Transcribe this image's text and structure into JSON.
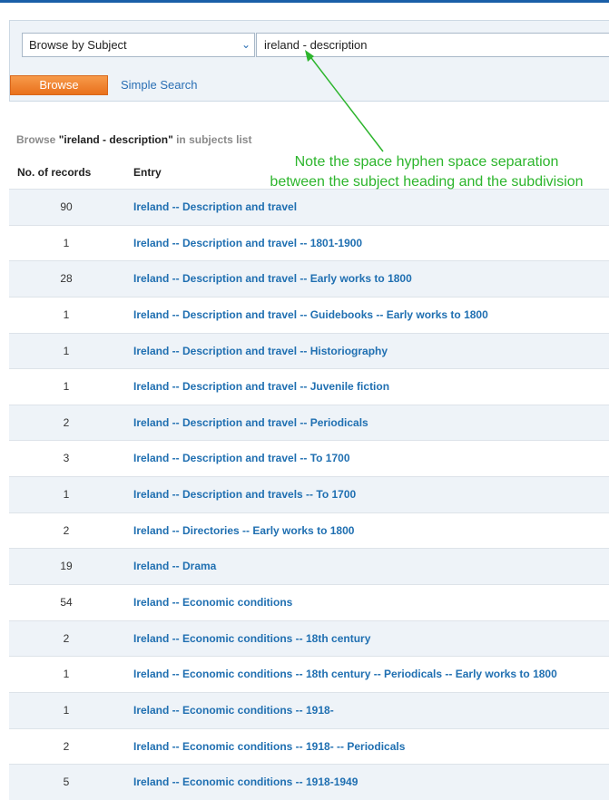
{
  "search": {
    "select_value": "Browse by Subject",
    "input_value": "ireland - description",
    "browse_label": "Browse",
    "simple_search_label": "Simple Search"
  },
  "results": {
    "heading_prefix": "Browse ",
    "heading_term": "\"ireland - description\"",
    "heading_suffix": " in subjects list",
    "col_records": "No. of records",
    "col_entry": "Entry",
    "rows": [
      {
        "count": "90",
        "entry": "Ireland -- Description and travel"
      },
      {
        "count": "1",
        "entry": "Ireland -- Description and travel -- 1801-1900"
      },
      {
        "count": "28",
        "entry": "Ireland -- Description and travel -- Early works to 1800"
      },
      {
        "count": "1",
        "entry": "Ireland -- Description and travel -- Guidebooks -- Early works to 1800"
      },
      {
        "count": "1",
        "entry": "Ireland -- Description and travel -- Historiography"
      },
      {
        "count": "1",
        "entry": "Ireland -- Description and travel -- Juvenile fiction"
      },
      {
        "count": "2",
        "entry": "Ireland -- Description and travel -- Periodicals"
      },
      {
        "count": "3",
        "entry": "Ireland -- Description and travel -- To 1700"
      },
      {
        "count": "1",
        "entry": "Ireland -- Description and travels -- To 1700"
      },
      {
        "count": "2",
        "entry": "Ireland -- Directories -- Early works to 1800"
      },
      {
        "count": "19",
        "entry": "Ireland -- Drama"
      },
      {
        "count": "54",
        "entry": "Ireland -- Economic conditions"
      },
      {
        "count": "2",
        "entry": "Ireland -- Economic conditions -- 18th century"
      },
      {
        "count": "1",
        "entry": "Ireland -- Economic conditions -- 18th century -- Periodicals -- Early works to 1800"
      },
      {
        "count": "1",
        "entry": "Ireland -- Economic conditions -- 1918-"
      },
      {
        "count": "2",
        "entry": "Ireland -- Economic conditions -- 1918- -- Periodicals"
      },
      {
        "count": "5",
        "entry": "Ireland -- Economic conditions -- 1918-1949"
      }
    ]
  },
  "annotation": {
    "line1": "Note the space hyphen space separation",
    "line2": "between the subject heading and the subdivision"
  }
}
